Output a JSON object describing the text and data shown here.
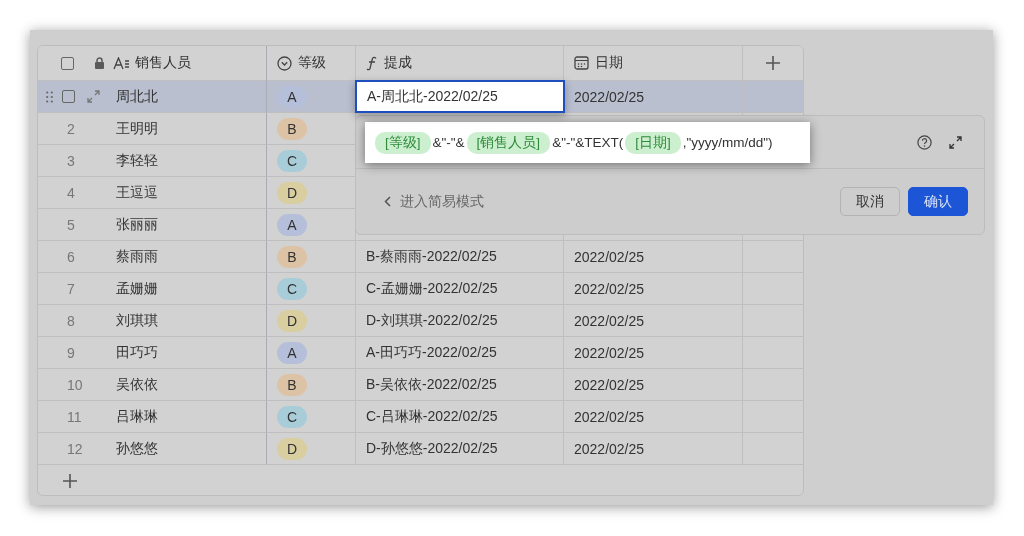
{
  "table": {
    "select_all": {
      "checked": false
    },
    "columns": [
      {
        "kind": "text",
        "label": "销售人员"
      },
      {
        "kind": "select",
        "label": "等级"
      },
      {
        "kind": "formula",
        "label": "提成"
      },
      {
        "kind": "date",
        "label": "日期"
      }
    ],
    "rows": [
      {
        "selected": true,
        "checked": false,
        "editing": true,
        "name": "周北北",
        "grade": {
          "label": "A",
          "color": "#b6bfd9"
        },
        "commission": "A-周北北-2022/02/25",
        "date": "2022/02/25"
      },
      {
        "selected": false,
        "editing": false,
        "number": "2",
        "name": "王明明",
        "grade": {
          "label": "B",
          "color": "#dcc3a6"
        }
      },
      {
        "selected": false,
        "editing": false,
        "number": "3",
        "name": "李轻轻",
        "grade": {
          "label": "C",
          "color": "#a8cdd8"
        }
      },
      {
        "selected": false,
        "editing": false,
        "number": "4",
        "name": "王逗逗",
        "grade": {
          "label": "D",
          "color": "#d8cea0"
        }
      },
      {
        "selected": false,
        "editing": false,
        "number": "5",
        "name": "张丽丽",
        "grade": {
          "label": "A",
          "color": "#b6bfd9"
        }
      },
      {
        "selected": false,
        "editing": false,
        "number": "6",
        "name": "蔡雨雨",
        "grade": {
          "label": "B",
          "color": "#dcc3a6"
        },
        "commission": "B-蔡雨雨-2022/02/25",
        "date": "2022/02/25"
      },
      {
        "selected": false,
        "editing": false,
        "number": "7",
        "name": "孟姗姗",
        "grade": {
          "label": "C",
          "color": "#a8cdd8"
        },
        "commission": "C-孟姗姗-2022/02/25",
        "date": "2022/02/25"
      },
      {
        "selected": false,
        "editing": false,
        "number": "8",
        "name": "刘琪琪",
        "grade": {
          "label": "D",
          "color": "#d8cea0"
        },
        "commission": "D-刘琪琪-2022/02/25",
        "date": "2022/02/25"
      },
      {
        "selected": false,
        "editing": false,
        "number": "9",
        "name": "田巧巧",
        "grade": {
          "label": "A",
          "color": "#b6bfd9"
        },
        "commission": "A-田巧巧-2022/02/25",
        "date": "2022/02/25"
      },
      {
        "selected": false,
        "editing": false,
        "number": "10",
        "name": "吴依依",
        "grade": {
          "label": "B",
          "color": "#dcc3a6"
        },
        "commission": "B-吴依依-2022/02/25",
        "date": "2022/02/25"
      },
      {
        "selected": false,
        "editing": false,
        "number": "11",
        "name": "吕琳琳",
        "grade": {
          "label": "C",
          "color": "#a8cdd8"
        },
        "commission": "C-吕琳琳-2022/02/25",
        "date": "2022/02/25"
      },
      {
        "selected": false,
        "editing": false,
        "number": "12",
        "name": "孙悠悠",
        "grade": {
          "label": "D",
          "color": "#d8cea0"
        },
        "commission": "D-孙悠悠-2022/02/25",
        "date": "2022/02/25"
      }
    ]
  },
  "formula_popup": {
    "tokens": [
      {
        "kind": "field",
        "text": "[等级]"
      },
      {
        "kind": "text",
        "text": "&\"-\"&"
      },
      {
        "kind": "field",
        "text": "[销售人员]"
      },
      {
        "kind": "text",
        "text": "&\"-\"&TEXT("
      },
      {
        "kind": "field",
        "text": "[日期]"
      },
      {
        "kind": "text",
        "text": ",\"yyyy/mm/dd\")"
      }
    ],
    "simple_mode_link": "进入简易模式",
    "buttons": [
      {
        "kind": "secondary",
        "label": "取消"
      },
      {
        "kind": "primary",
        "label": "确认"
      }
    ]
  }
}
